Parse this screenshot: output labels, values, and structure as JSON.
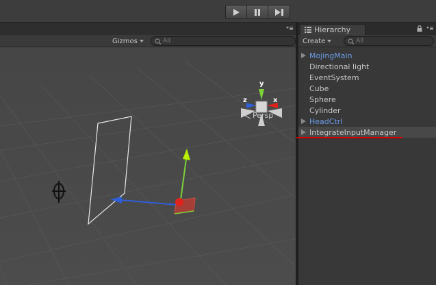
{
  "toolbar": {
    "play_icons": [
      "play-icon",
      "pause-icon",
      "step-icon"
    ]
  },
  "scene": {
    "gizmos_label": "Gizmos",
    "search_placeholder": "All",
    "projection_label": "Persp",
    "axis_labels": {
      "y": "y",
      "x": "x",
      "z": "z"
    }
  },
  "hierarchy": {
    "tab_label": "Hierarchy",
    "create_label": "Create",
    "search_placeholder": "All",
    "items": [
      {
        "label": "MojingMain",
        "expandable": true,
        "prefab": true
      },
      {
        "label": "Directional light",
        "expandable": false,
        "prefab": false
      },
      {
        "label": "EventSystem",
        "expandable": false,
        "prefab": false
      },
      {
        "label": "Cube",
        "expandable": false,
        "prefab": false
      },
      {
        "label": "Sphere",
        "expandable": false,
        "prefab": false
      },
      {
        "label": "Cylinder",
        "expandable": false,
        "prefab": false
      },
      {
        "label": "HeadCtrl",
        "expandable": true,
        "prefab": true
      },
      {
        "label": "IntegrateInputManager",
        "expandable": true,
        "prefab": false,
        "selected": true
      }
    ]
  },
  "colors": {
    "prefab_text": "#6a9de8",
    "highlight_underline": "#d40000",
    "axis_x": "#e0221c",
    "axis_y": "#7dd23a",
    "axis_z": "#2f5fd8"
  }
}
